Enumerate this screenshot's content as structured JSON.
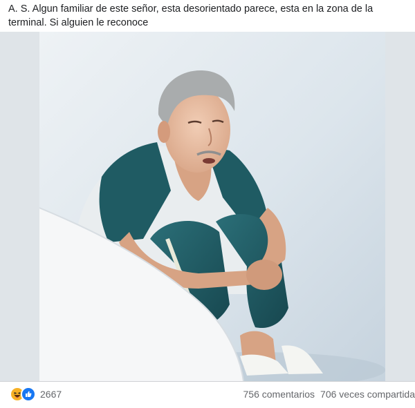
{
  "post": {
    "text": "A. S. Algun familiar de este señor, esta desorientado parece, esta en la zona de la terminal. Si alguien le reconoce"
  },
  "photo": {
    "subject": "elderly-man-sitting"
  },
  "footer": {
    "reaction_icons": [
      "haha-icon",
      "like-icon"
    ],
    "reaction_count": "2667",
    "comments": "756 comentarios",
    "shares": "706 veces compartida"
  },
  "colors": {
    "like_blue": "#1877f2",
    "haha_yellow": "#f7b125",
    "meta_text": "#65676b"
  }
}
